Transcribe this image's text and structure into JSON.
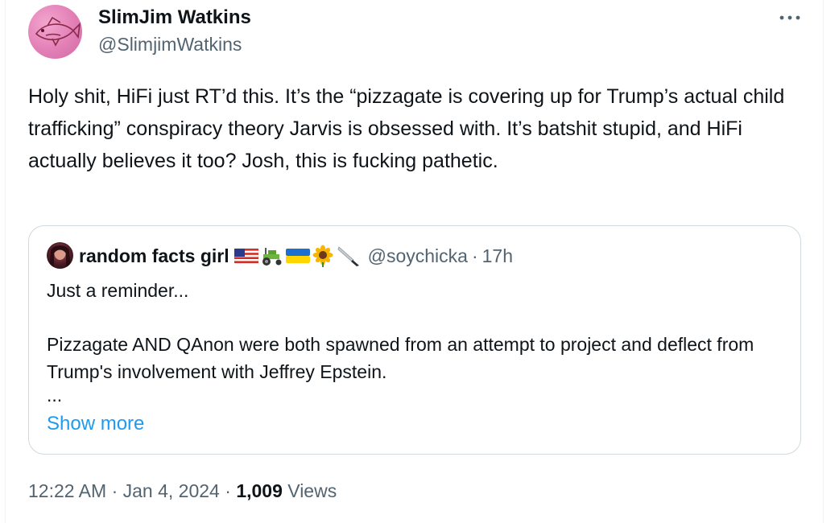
{
  "tweet": {
    "author_name": "SlimJim Watkins",
    "author_handle": "@SlimjimWatkins",
    "avatar_icon": "fish-avatar",
    "more_icon": "more-options-icon",
    "text": "Holy shit, HiFi just RT’d this. It’s the “pizzagate is covering up for Trump’s actual child trafficking” conspiracy theory Jarvis is obsessed with. It’s batshit stupid, and HiFi actually believes it too? Josh, this is fucking pathetic.",
    "time": "12:22 AM",
    "date": "Jan 4, 2024",
    "views_count": "1,009",
    "views_label": "Views",
    "separator": "·"
  },
  "quote": {
    "author_name": "random facts girl",
    "author_handle": "@soychicka",
    "relative_time": "17h",
    "separator": "·",
    "emojis": [
      "us-flag-emoji",
      "tractor-emoji",
      "ukraine-flag-emoji",
      "sunflower-emoji",
      "knife-emoji"
    ],
    "line1": "Just a reminder...",
    "paragraph": "Pizzagate AND QAnon were both spawned from an attempt to project and deflect from Trump's involvement with Jeffrey Epstein.",
    "ellipsis": "...",
    "show_more": "Show more"
  },
  "colors": {
    "text": "#0f1419",
    "secondary": "#536471",
    "link": "#1d9bf0",
    "border": "#cfd9de"
  }
}
